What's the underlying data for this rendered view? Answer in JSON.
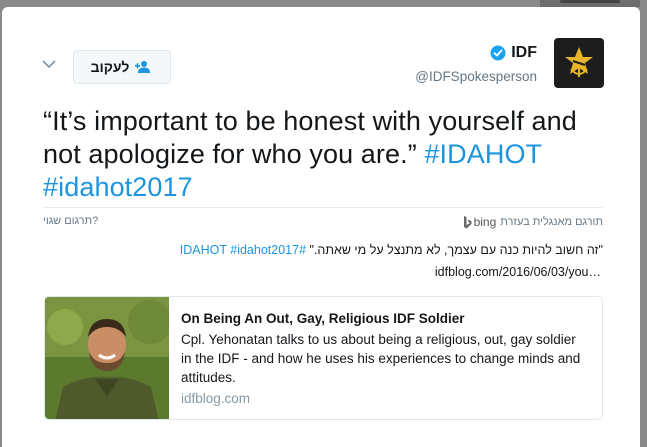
{
  "account": {
    "name": "IDF",
    "handle": "@IDFSpokesperson",
    "verified": true,
    "avatar_icon": "idf-emblem-icon"
  },
  "follow_button": {
    "label": "לעקוב",
    "icon": "add-user-icon"
  },
  "tweet": {
    "text": "“It’s important to be honest with yourself and not apologize for who you are.”",
    "hashtags": [
      "#IDAHOT",
      "#idahot2017"
    ]
  },
  "translation": {
    "translated_by": "תורגם מאנגלית בעזרת",
    "provider": "bing",
    "wrong_translation": "תרגום שגוי?",
    "text": "\"זה חשוב להיות כנה עם עצמך, לא מתנצל על מי שאתה.\"",
    "hashtags": "#IDAHOT #idahot2017",
    "link": "idfblog.com/2016/06/03/you…"
  },
  "card": {
    "title": "On Being An Out, Gay, Religious IDF Soldier",
    "description": "Cpl. Yehonatan talks to us about being a religious, out, gay soldier in the IDF - and how he uses his experiences to change minds and attitudes.",
    "domain": "idfblog.com"
  },
  "colors": {
    "text": "#14171a",
    "secondary": "#657786",
    "link": "#1b95e0",
    "verified": "#1da1f2",
    "overlay": "#8a8a8a"
  }
}
